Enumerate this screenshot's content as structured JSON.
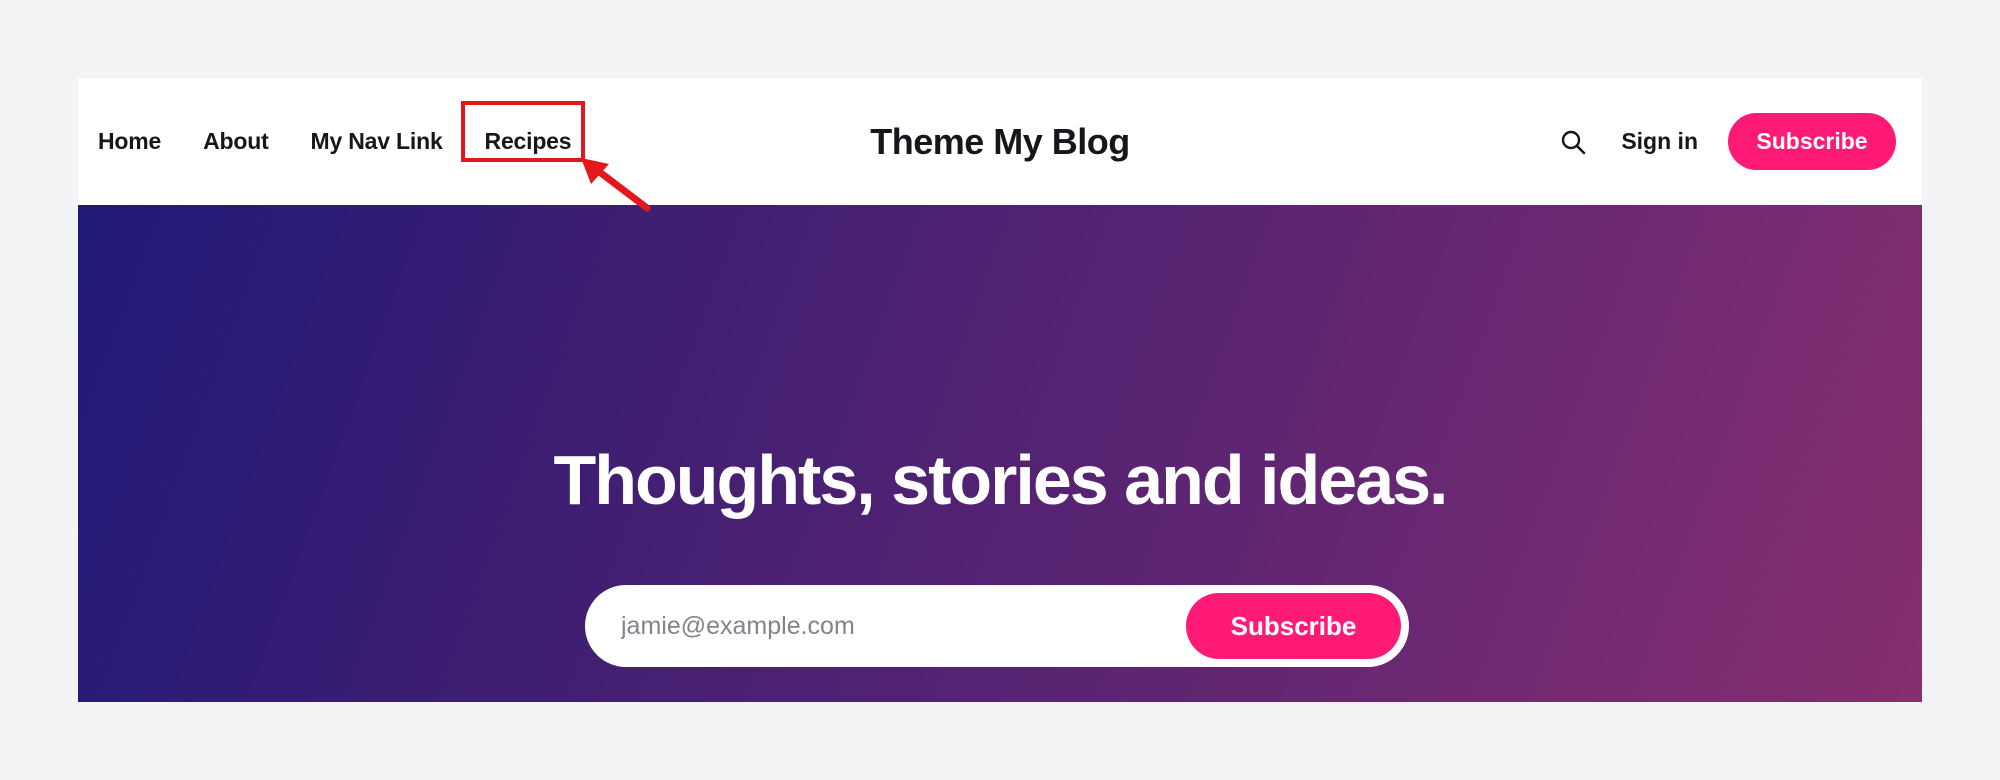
{
  "nav": {
    "items": [
      {
        "label": "Home"
      },
      {
        "label": "About"
      },
      {
        "label": "My Nav Link"
      },
      {
        "label": "Recipes"
      }
    ]
  },
  "site": {
    "title": "Theme My Blog"
  },
  "header": {
    "search_icon": "search-icon",
    "signin_label": "Sign in",
    "subscribe_label": "Subscribe"
  },
  "hero": {
    "title": "Thoughts, stories and ideas.",
    "email_placeholder": "jamie@example.com",
    "subscribe_label": "Subscribe"
  },
  "colors": {
    "accent": "#ff1a75",
    "annotation": "#e3171c",
    "hero_gradient_start": "#1f1a77",
    "hero_gradient_end": "#862e70"
  }
}
